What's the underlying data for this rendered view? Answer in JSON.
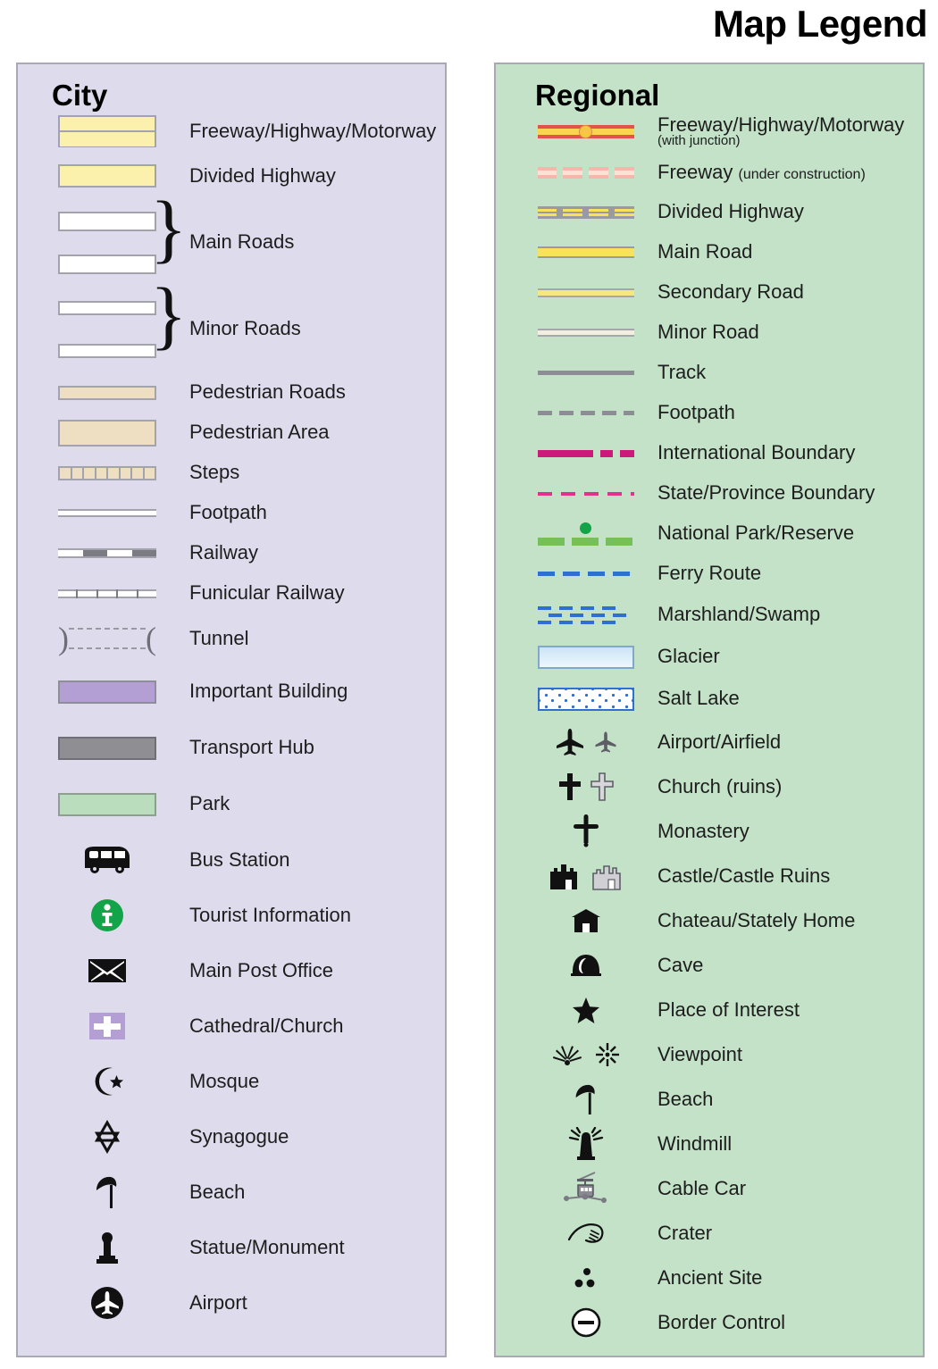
{
  "title": "Map Legend",
  "panels": {
    "city": {
      "heading": "City",
      "bg_color": "#dedcec",
      "items": [
        {
          "label": "Freeway/Highway/Motorway",
          "symbol": "freeway-city"
        },
        {
          "label": "Divided Highway",
          "symbol": "divided-highway-city"
        },
        {
          "label": "Main Roads",
          "symbol": "main-roads-pair"
        },
        {
          "label": "Minor Roads",
          "symbol": "minor-roads-pair"
        },
        {
          "label": "Pedestrian Roads",
          "symbol": "pedestrian-road"
        },
        {
          "label": "Pedestrian Area",
          "symbol": "pedestrian-area"
        },
        {
          "label": "Steps",
          "symbol": "steps"
        },
        {
          "label": "Footpath",
          "symbol": "footpath"
        },
        {
          "label": "Railway",
          "symbol": "railway"
        },
        {
          "label": "Funicular Railway",
          "symbol": "funicular-railway"
        },
        {
          "label": "Tunnel",
          "symbol": "tunnel"
        },
        {
          "label": "Important Building",
          "symbol": "important-building"
        },
        {
          "label": "Transport Hub",
          "symbol": "transport-hub"
        },
        {
          "label": "Park",
          "symbol": "park"
        },
        {
          "label": "Bus Station",
          "symbol": "bus-icon"
        },
        {
          "label": "Tourist Information",
          "symbol": "information-icon"
        },
        {
          "label": "Main Post Office",
          "symbol": "envelope-icon"
        },
        {
          "label": "Cathedral/Church",
          "symbol": "church-cross-icon"
        },
        {
          "label": "Mosque",
          "symbol": "star-and-crescent-icon"
        },
        {
          "label": "Synagogue",
          "symbol": "star-of-david-icon"
        },
        {
          "label": "Beach",
          "symbol": "parasol-icon"
        },
        {
          "label": "Statue/Monument",
          "symbol": "statue-icon"
        },
        {
          "label": "Airport",
          "symbol": "airplane-circle-icon"
        }
      ]
    },
    "regional": {
      "heading": "Regional",
      "bg_color": "#c3e2c8",
      "items": [
        {
          "label": "Freeway/Highway/Motorway",
          "sublabel": "(with junction)",
          "sub_style": "block",
          "symbol": "freeway-junction"
        },
        {
          "label": "Freeway",
          "sublabel": "(under construction)",
          "sub_style": "inline",
          "symbol": "freeway-under-construction"
        },
        {
          "label": "Divided Highway",
          "symbol": "divided-highway"
        },
        {
          "label": "Main Road",
          "symbol": "main-road"
        },
        {
          "label": "Secondary Road",
          "symbol": "secondary-road"
        },
        {
          "label": "Minor Road",
          "symbol": "minor-road"
        },
        {
          "label": "Track",
          "symbol": "track"
        },
        {
          "label": "Footpath",
          "symbol": "footpath-dashed"
        },
        {
          "label": "International Boundary",
          "symbol": "international-boundary"
        },
        {
          "label": "State/Province Boundary",
          "symbol": "state-boundary"
        },
        {
          "label": "National Park/Reserve",
          "symbol": "national-park"
        },
        {
          "label": "Ferry Route",
          "symbol": "ferry-route"
        },
        {
          "label": "Marshland/Swamp",
          "symbol": "marshland"
        },
        {
          "label": "Glacier",
          "symbol": "glacier"
        },
        {
          "label": "Salt Lake",
          "symbol": "salt-lake"
        },
        {
          "label": "Airport/Airfield",
          "symbol": "airport-airfield-icon"
        },
        {
          "label": "Church (ruins)",
          "symbol": "church-ruins-icon"
        },
        {
          "label": "Monastery",
          "symbol": "monastery-cross-icon"
        },
        {
          "label": "Castle/Castle Ruins",
          "symbol": "castle-icon"
        },
        {
          "label": "Chateau/Stately Home",
          "symbol": "chateau-icon"
        },
        {
          "label": "Cave",
          "symbol": "cave-icon"
        },
        {
          "label": "Place of Interest",
          "symbol": "star-icon"
        },
        {
          "label": "Viewpoint",
          "symbol": "viewpoint-icon"
        },
        {
          "label": "Beach",
          "symbol": "parasol-icon"
        },
        {
          "label": "Windmill",
          "symbol": "windmill-icon"
        },
        {
          "label": "Cable Car",
          "symbol": "cable-car-icon"
        },
        {
          "label": "Crater",
          "symbol": "crater-icon"
        },
        {
          "label": "Ancient Site",
          "symbol": "ancient-site-icon"
        },
        {
          "label": "Border Control",
          "symbol": "border-control-icon"
        }
      ]
    }
  },
  "colors": {
    "city_panel_bg": "#dedcec",
    "regional_panel_bg": "#c3e2c8",
    "panel_border": "#a9a9b4",
    "highway_yellow": "#fbf1ac",
    "freeway_red": "#e1544c",
    "road_yellow": "#f8e25c",
    "pedestrian_tan": "#eedfc3",
    "important_building_purple": "#b49fd4",
    "transport_hub_gray": "#8f8f93",
    "park_green": "#b9ddbd",
    "information_green": "#13a44a",
    "boundary_magenta": "#cc1a7b",
    "state_boundary_pink": "#e0318f",
    "park_line_green": "#76c157",
    "ferry_blue": "#2f6fd0",
    "glacier_blue": "#cbe4f6"
  }
}
